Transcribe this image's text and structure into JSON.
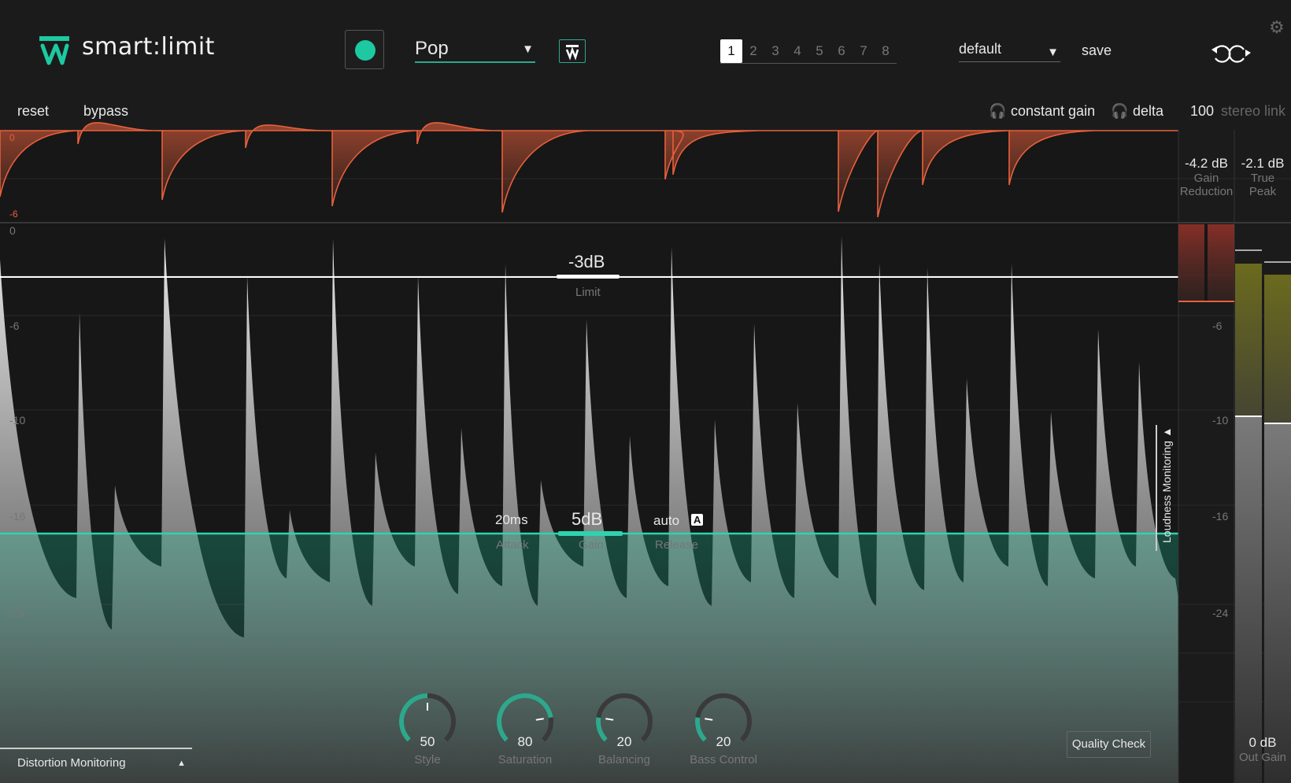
{
  "app": {
    "title": "smart:limit",
    "accent": "#1dc9a0",
    "gr_color": "#e8603c"
  },
  "header": {
    "preset": "Pop",
    "tabs": [
      "1",
      "2",
      "3",
      "4",
      "5",
      "6",
      "7",
      "8"
    ],
    "active_tab": "1",
    "profile": "default",
    "save_label": "save"
  },
  "toolbar": {
    "reset": "reset",
    "bypass": "bypass",
    "constant_gain": "constant gain",
    "delta": "delta",
    "stereo_link_value": "100",
    "stereo_link_label": "stereo link"
  },
  "gr_strip": {
    "scale_top": "0",
    "scale_bottom": "-6"
  },
  "meters": {
    "gain_reduction_value": "-4.2 dB",
    "gain_reduction_label_1": "Gain",
    "gain_reduction_label_2": "Reduction",
    "true_peak_value": "-2.1 dB",
    "true_peak_label_1": "True",
    "true_peak_label_2": "Peak",
    "out_gain_value": "0 dB",
    "out_gain_label": "Out Gain"
  },
  "scale": [
    "0",
    "-6",
    "-10",
    "-16",
    "-24"
  ],
  "limit": {
    "value": "-3dB",
    "label": "Limit"
  },
  "gain": {
    "value": "5dB",
    "label": "Gain"
  },
  "attack": {
    "value": "20ms",
    "label": "Attack"
  },
  "release": {
    "value": "auto",
    "badge": "A",
    "label": "Release"
  },
  "knobs": [
    {
      "value": "50",
      "label": "Style",
      "level": 50
    },
    {
      "value": "80",
      "label": "Saturation",
      "level": 80
    },
    {
      "value": "20",
      "label": "Balancing",
      "level": 20
    },
    {
      "value": "20",
      "label": "Bass Control",
      "level": 20
    }
  ],
  "quality_check": "Quality Check",
  "distortion_monitoring": "Distortion Monitoring",
  "loudness_monitoring": "Loudness Monitoring ▲"
}
